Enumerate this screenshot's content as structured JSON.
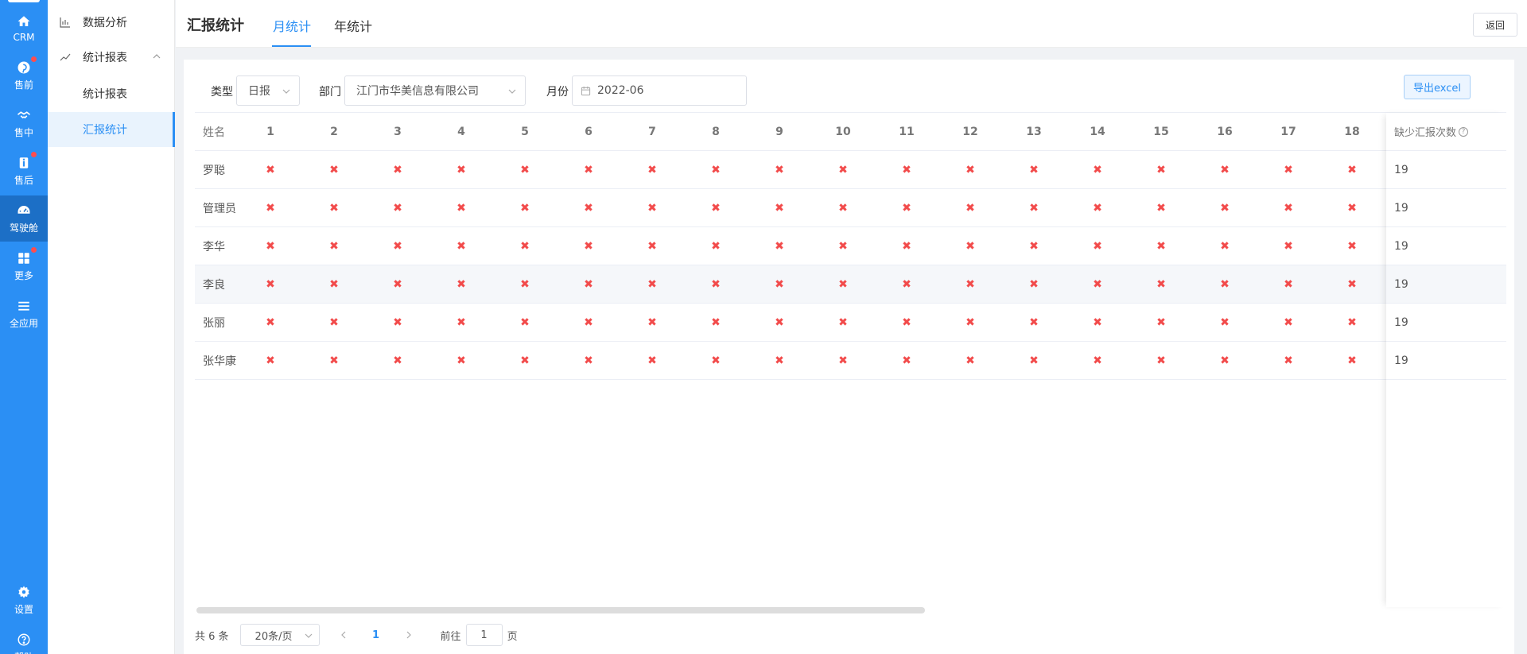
{
  "rail": {
    "items": [
      {
        "label": "CRM",
        "icon": "home-icon",
        "dot": false,
        "active": false
      },
      {
        "label": "售前",
        "icon": "pinterest-icon",
        "dot": true,
        "active": false
      },
      {
        "label": "售中",
        "icon": "handshake-icon",
        "dot": false,
        "active": false
      },
      {
        "label": "售后",
        "icon": "info-icon",
        "dot": true,
        "active": false
      },
      {
        "label": "驾驶舱",
        "icon": "dashboard-icon",
        "dot": false,
        "active": true
      },
      {
        "label": "更多",
        "icon": "grid-icon",
        "dot": true,
        "active": false
      },
      {
        "label": "全应用",
        "icon": "menu-icon",
        "dot": false,
        "active": false
      }
    ],
    "settings_label": "设置",
    "help_label": "帮助"
  },
  "subnav": {
    "data_analysis": "数据分析",
    "stat_report_group": "统计报表",
    "stat_report": "统计报表",
    "summary_stat": "汇报统计"
  },
  "header": {
    "title": "汇报统计",
    "tabs": [
      "月统计",
      "年统计"
    ],
    "active_tab": "月统计",
    "back_label": "返回"
  },
  "filters": {
    "type_label": "类型",
    "type_value": "日报",
    "dept_label": "部门",
    "dept_value": "江门市华美信息有限公司",
    "month_label": "月份",
    "month_value": "2022-06",
    "export_label": "导出excel"
  },
  "table": {
    "name_header": "姓名",
    "day_headers": [
      "1",
      "2",
      "3",
      "4",
      "5",
      "6",
      "7",
      "8",
      "9",
      "10",
      "11",
      "12",
      "13",
      "14",
      "15",
      "16",
      "17",
      "18"
    ],
    "missing_header": "缺少汇报次数",
    "help_glyph": "?",
    "missing_mark": "✖",
    "rows": [
      {
        "name": "罗聪",
        "missing": "19"
      },
      {
        "name": "管理员",
        "missing": "19"
      },
      {
        "name": "李华",
        "missing": "19"
      },
      {
        "name": "李良",
        "missing": "19"
      },
      {
        "name": "张丽",
        "missing": "19"
      },
      {
        "name": "张华康",
        "missing": "19"
      }
    ]
  },
  "pager": {
    "total": "共 6 条",
    "page_size": "20条/页",
    "current_page": "1",
    "goto_label": "前往",
    "goto_value": "1",
    "page_unit": "页"
  }
}
